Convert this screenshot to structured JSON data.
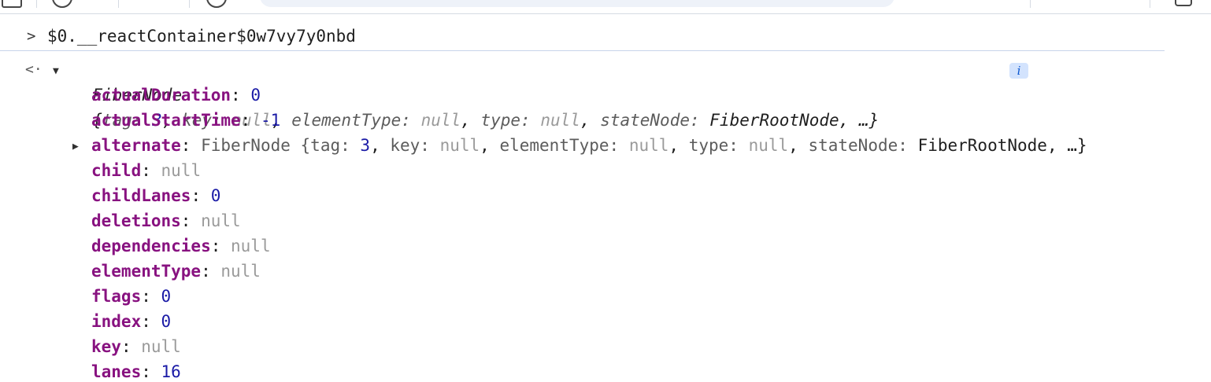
{
  "toolbar": {
    "icons": [
      "sidebar-icon",
      "clear-console-icon",
      "context-icon",
      "settings-icon"
    ],
    "filter_placeholder": ""
  },
  "console": {
    "prompt_symbol": ">",
    "result_symbol": "<·",
    "input_expression": "$0.__reactContainer$0w7vy7y0nbd",
    "summary": {
      "class_name": "FiberNode",
      "open_brace": "{",
      "entries": [
        {
          "key": "tag",
          "value": "3",
          "kind": "num"
        },
        {
          "key": "key",
          "value": "null",
          "kind": "null"
        },
        {
          "key": "elementType",
          "value": "null",
          "kind": "null"
        },
        {
          "key": "type",
          "value": "null",
          "kind": "null"
        },
        {
          "key": "stateNode",
          "value": "FiberRootNode",
          "kind": "plain"
        }
      ],
      "ellipsis": "…}",
      "info_badge": "i"
    },
    "properties": [
      {
        "name": "actualDuration",
        "value": "0",
        "kind": "num"
      },
      {
        "name": "actualStartTime",
        "value": "-1",
        "kind": "num"
      },
      {
        "name": "alternate",
        "value": "FiberNode {tag: 3, key: null, elementType: null, type: null, stateNode: FiberRootNode, …}",
        "kind": "object",
        "expandable": true,
        "object_parts": [
          {
            "t": "FiberNode {",
            "c": "sub"
          },
          {
            "t": "tag",
            "c": "sub"
          },
          {
            "t": ": ",
            "c": "sub"
          },
          {
            "t": "3",
            "c": "num"
          },
          {
            "t": ", ",
            "c": "plain"
          },
          {
            "t": "key",
            "c": "sub"
          },
          {
            "t": ": ",
            "c": "sub"
          },
          {
            "t": "null",
            "c": "null"
          },
          {
            "t": ", ",
            "c": "plain"
          },
          {
            "t": "elementType",
            "c": "sub"
          },
          {
            "t": ": ",
            "c": "sub"
          },
          {
            "t": "null",
            "c": "null"
          },
          {
            "t": ", ",
            "c": "plain"
          },
          {
            "t": "type",
            "c": "sub"
          },
          {
            "t": ": ",
            "c": "sub"
          },
          {
            "t": "null",
            "c": "null"
          },
          {
            "t": ", ",
            "c": "plain"
          },
          {
            "t": "stateNode",
            "c": "sub"
          },
          {
            "t": ": ",
            "c": "sub"
          },
          {
            "t": "FiberRootNode",
            "c": "plain"
          },
          {
            "t": ", …}",
            "c": "plain"
          }
        ]
      },
      {
        "name": "child",
        "value": "null",
        "kind": "null"
      },
      {
        "name": "childLanes",
        "value": "0",
        "kind": "num"
      },
      {
        "name": "deletions",
        "value": "null",
        "kind": "null"
      },
      {
        "name": "dependencies",
        "value": "null",
        "kind": "null"
      },
      {
        "name": "elementType",
        "value": "null",
        "kind": "null"
      },
      {
        "name": "flags",
        "value": "0",
        "kind": "num"
      },
      {
        "name": "index",
        "value": "0",
        "kind": "num"
      },
      {
        "name": "key",
        "value": "null",
        "kind": "null"
      },
      {
        "name": "lanes",
        "value": "16",
        "kind": "num"
      }
    ]
  },
  "colors": {
    "property_name": "#881280",
    "number": "#1a1aa6",
    "null": "#9a9a9a",
    "info_badge_bg": "#d3e3fd"
  }
}
